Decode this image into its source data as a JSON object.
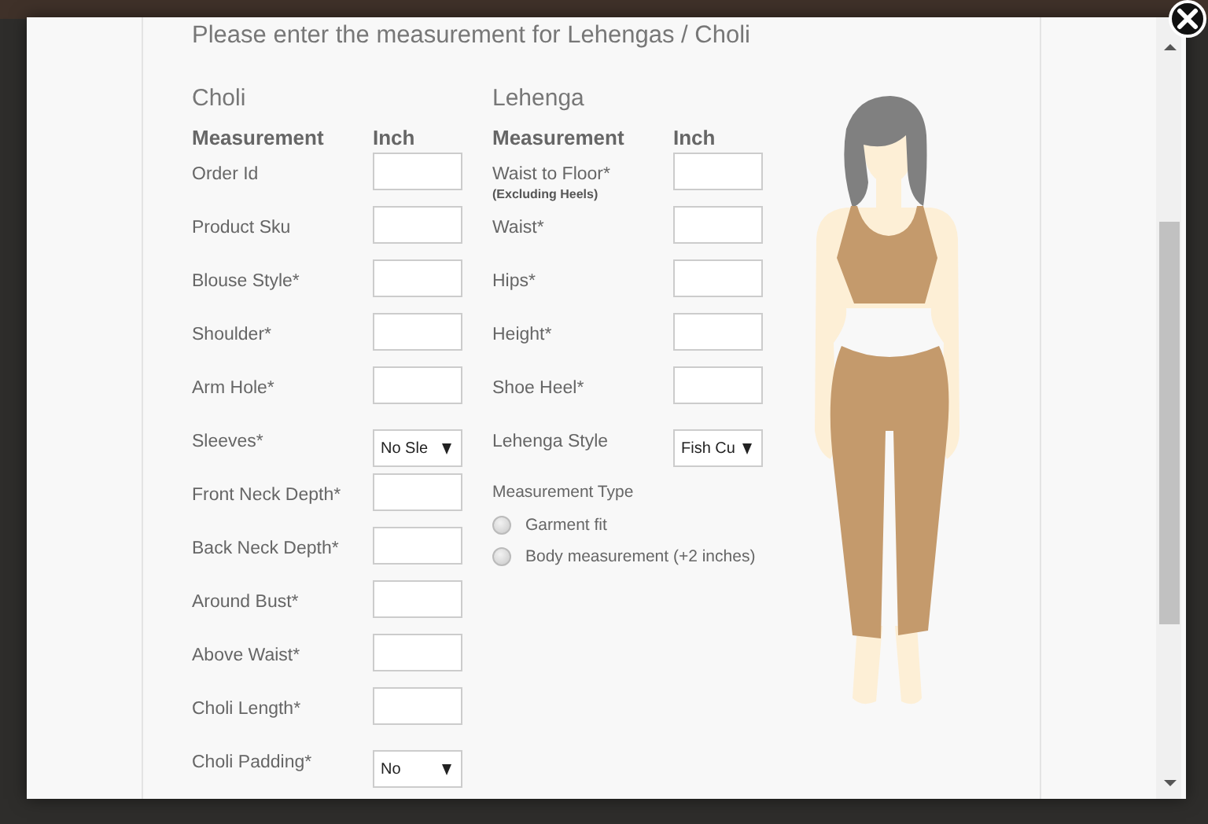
{
  "dialog": {
    "title": "Please enter the measurement for Lehengas / Choli",
    "sections": [
      {
        "heading": "Choli",
        "columns": [
          "Measurement",
          "Inch"
        ],
        "fields": [
          {
            "label": "Order Id",
            "kind": "text"
          },
          {
            "label": "Product Sku",
            "kind": "text"
          },
          {
            "label": "Blouse Style*",
            "kind": "text"
          },
          {
            "label": "Shoulder*",
            "kind": "text"
          },
          {
            "label": "Arm Hole*",
            "kind": "text"
          },
          {
            "label": "Sleeves*",
            "kind": "select",
            "value": "No Sle"
          },
          {
            "label": "Front Neck Depth*",
            "kind": "text"
          },
          {
            "label": "Back Neck Depth*",
            "kind": "text"
          },
          {
            "label": "Around Bust*",
            "kind": "text"
          },
          {
            "label": "Above Waist*",
            "kind": "text"
          },
          {
            "label": "Choli Length*",
            "kind": "text"
          },
          {
            "label": "Choli Padding*",
            "kind": "select",
            "value": "No"
          }
        ]
      },
      {
        "heading": "Lehenga",
        "columns": [
          "Measurement",
          "Inch"
        ],
        "fields": [
          {
            "label": "Waist to Floor*",
            "note": "(Excluding Heels)",
            "kind": "text"
          },
          {
            "label": "Waist*",
            "kind": "text"
          },
          {
            "label": "Hips*",
            "kind": "text"
          },
          {
            "label": "Height*",
            "kind": "text"
          },
          {
            "label": "Shoe Heel*",
            "kind": "text"
          },
          {
            "label": "Lehenga Style",
            "kind": "select",
            "value": "Fish Cu"
          }
        ],
        "measurement_type": {
          "label": "Measurement Type",
          "options": [
            {
              "label": "Garment fit",
              "selected": false
            },
            {
              "label": "Body measurement (+2 inches)",
              "selected": false
            }
          ]
        }
      }
    ]
  }
}
